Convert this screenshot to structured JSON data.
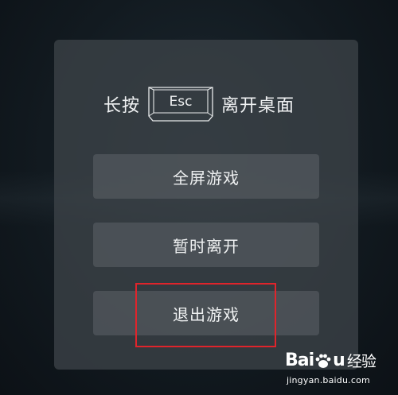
{
  "dialog": {
    "title_prefix": "长按",
    "key_label": "Esc",
    "title_suffix": "离开桌面"
  },
  "buttons": {
    "fullscreen": "全屏游戏",
    "pause": "暂时离开",
    "exit": "退出游戏"
  },
  "annotation": {
    "highlight_color": "#e0242b"
  },
  "watermark": {
    "brand_part1": "Bai",
    "brand_part2": "u",
    "brand_cn": "经验",
    "url": "jingyan.baidu.com"
  }
}
